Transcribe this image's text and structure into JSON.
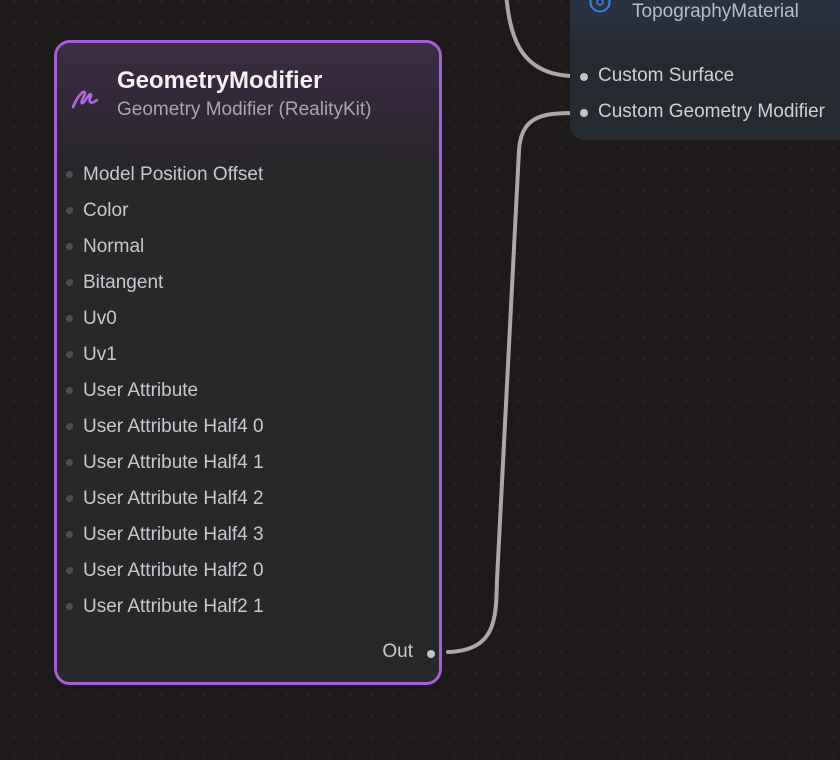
{
  "geometry_node": {
    "title": "GeometryModifier",
    "subtitle": "Geometry Modifier (RealityKit)",
    "icon": "brush-stroke-icon",
    "accent_color": "#a45fd6",
    "inputs": [
      "Model Position Offset",
      "Color",
      "Normal",
      "Bitangent",
      "Uv0",
      "Uv1",
      "User Attribute",
      "User Attribute Half4 0",
      "User Attribute Half4 1",
      "User Attribute Half4 2",
      "User Attribute Half4 3",
      "User Attribute Half2 0",
      "User Attribute Half2 1"
    ],
    "output": "Out"
  },
  "material_node": {
    "subtitle": "TopographyMaterial",
    "icon": "material-circle-icon",
    "accent_color": "#3f7de6",
    "inputs": [
      "Custom Surface",
      "Custom Geometry Modifier"
    ]
  },
  "connections": [
    {
      "from": "GeometryModifier.Out",
      "to": "TopographyMaterial.Custom Geometry Modifier"
    },
    {
      "from": "offscreen",
      "to": "TopographyMaterial.Custom Surface"
    }
  ],
  "colors": {
    "canvas_bg": "#1d1a19",
    "wire": "#a9a9ab"
  }
}
